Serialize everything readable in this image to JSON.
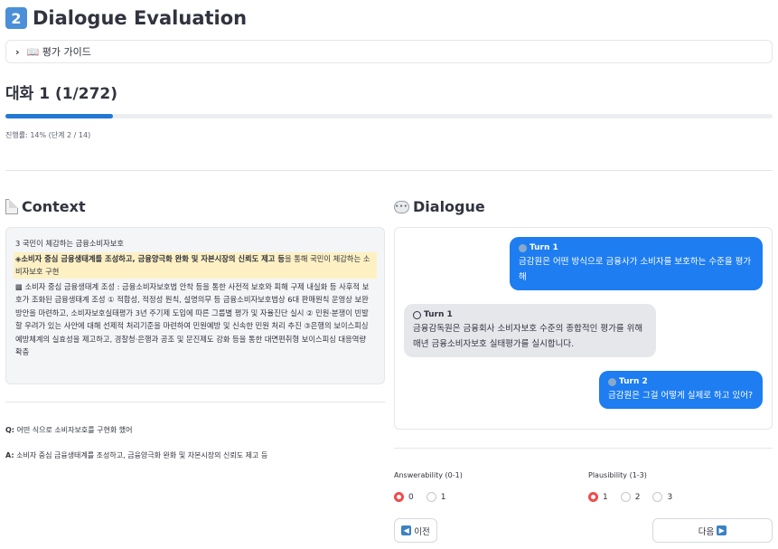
{
  "header": {
    "badge": "2",
    "title": "Dialogue Evaluation"
  },
  "guide": {
    "icon": "book-icon",
    "label": "📖 평가 가이드"
  },
  "dialogue_header": "대화 1 (1/272)",
  "progress": {
    "fraction": 0.14,
    "text": "진행률: 14% (단계 2 / 14)",
    "color": "#2378d4"
  },
  "context": {
    "heading": "Context",
    "lines": {
      "title": "3 국민이 체감하는 금융소비자보호",
      "hl_bold": "◈소비자 중심 금융생태계를 조성하고, 금융양극화 완화 및 자본시장의 신뢰도 제고 등",
      "hl_rest": "을 통해 국민이 체감하는 소비자보호 구현",
      "body": "▩ 소비자 중심 금융생태계 조성 : 금융소비자보호법 안착 등을 통한 사전적 보호와 피해 구제 내실화 등 사후적 보호가 조화된 금융생태계 조성 ① 적합성, 적정성 원칙, 설명의무 등 금융소비자보호법상 6대 판매원칙 운영상 보완방안을 마련하고, 소비자보호실태평가 3년 주기제 도입에 따른 그룹별 평가 및 자율진단 실시 ② 민원·분쟁이 빈발할 우려가 있는 사안에 대해 선제적 처리기준을 마련하여 민원예방 및 신속한 민원 처리 추진 ③은행의 보이스피싱 예방체계의 실효성을 제고하고, 경찰청·은행과 공조 및 문진제도 강화 등을 통한 대면편취형 보이스피싱 대응역량 확충"
    }
  },
  "qa": {
    "q_label": "Q:",
    "q_text": "어떤 식으로 소비자보호를 구현화 했어",
    "a_label": "A:",
    "a_text": "소비자 중심 금융생태계를 조성하고, 금융양극화 완화 및 자본시장의 신뢰도 제고 등"
  },
  "dialogue": {
    "heading": "Dialogue",
    "turns": [
      {
        "role": "user",
        "label": "Turn 1",
        "text": "금감원은 어떤 방식으로 금융사가 소비자를 보호하는 수준을 평가해"
      },
      {
        "role": "bot",
        "label": "Turn 1",
        "text": "금융감독원은 금융회사 소비자보호 수준의 종합적인 평가를 위해 매년 금융소비자보호 실태평가를 실시합니다."
      },
      {
        "role": "user",
        "label": "Turn 2",
        "text": "금감원은 그걸 어떻게 실제로 하고 있어?"
      }
    ]
  },
  "answerability": {
    "label": "Answerability (0-1)",
    "options": [
      "0",
      "1"
    ],
    "selected": "0"
  },
  "plausibility": {
    "label": "Plausibility (1-3)",
    "options": [
      "1",
      "2",
      "3"
    ],
    "selected": "1"
  },
  "nav": {
    "prev_label": "이전",
    "next_label": "다음"
  },
  "colors": {
    "accent_red": "#f04b4b",
    "user_bubble": "#1e7df0",
    "bot_bubble": "#e5e7eb",
    "highlight": "#fdf1c4"
  }
}
